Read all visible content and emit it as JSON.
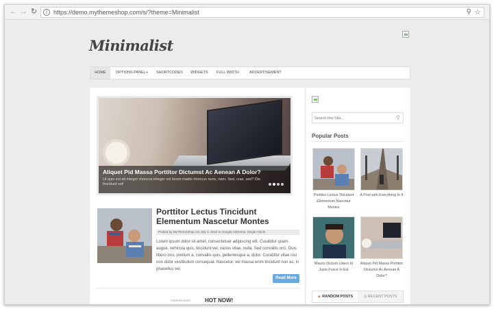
{
  "browser": {
    "url": "https://demo.mythemeshop.com/s/?theme=Minimalist"
  },
  "site": {
    "logo": "Minimalist"
  },
  "menu": {
    "items": [
      "Home",
      "Options Panel+",
      "Shortcodes",
      "Widgets",
      "Full Width",
      "Advertisement"
    ]
  },
  "slider": {
    "title": "Aliquet Pid Massa Porttitor Dictumst Ac Aenean A Dolor?",
    "desc": "Ut quis est sit integer rhoncus integer vel lorem mattis rhoncus nunc, nam. Sed, cras, sed? Dis tincidunt vel!"
  },
  "post": {
    "title": "Porttitor Lectus Tincidunt Elementum Nascetur Montes",
    "meta": "Posted by MyThemeShop On July 2, 2010 In Google AdSense, Single Article",
    "excerpt": "Lorem ipsum dolor sit amet, consectetuer adipiscing elit. Curabitur quam augue, vehicula quis, tincidunt vel, varius vitae, nulla. Sed convallis orci. Duis libero orci, pretium a, convallis quis, pellentesque a, dolor. Curabitur vitae nisi non dolor vestibulum consequat. Nascetur, vel massa enim tincidunt non ac, in phasellus vel.",
    "read_more": "Read More"
  },
  "section": {
    "adv": "Advertisement",
    "hot": "HOT NOW!"
  },
  "sidebar": {
    "search_placeholder": "Search this Site...",
    "popular_heading": "Popular Posts",
    "popular": [
      {
        "title": "Porttitor Lectus Tincidunt Elementum Nascetur Montes"
      },
      {
        "title": "A Post with Everything In It"
      },
      {
        "title": "Mauris Dictum Libero Id Justo Fusce In Est"
      },
      {
        "title": "Aliquet Pid Massa Porttitor Dictumst Ac Aenean A Dolor?"
      }
    ],
    "tabs": [
      "Random Posts",
      "Recent Posts"
    ]
  },
  "colors": {
    "accent": "#6aa9e0",
    "flame": "#e7692e"
  }
}
